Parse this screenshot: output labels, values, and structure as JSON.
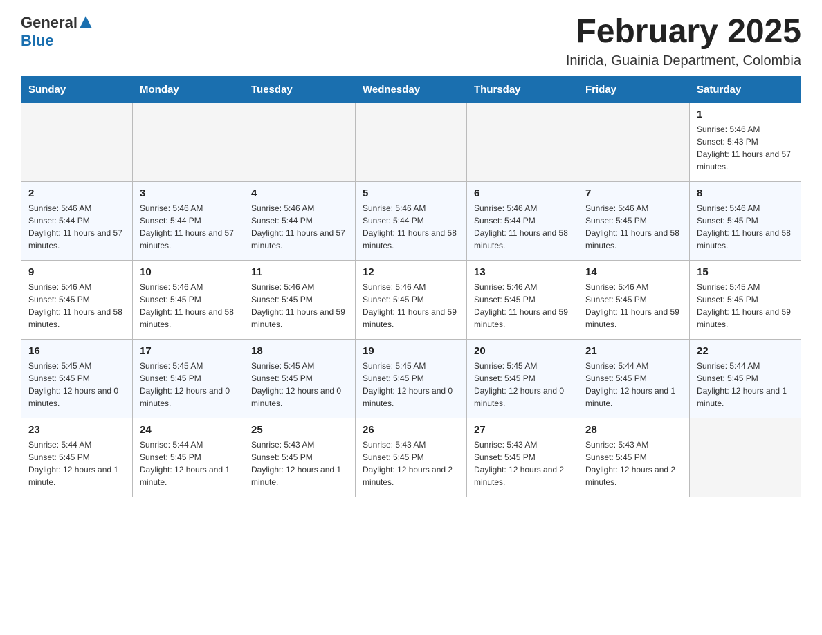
{
  "header": {
    "logo_general": "General",
    "logo_blue": "Blue",
    "title": "February 2025",
    "subtitle": "Inirida, Guainia Department, Colombia"
  },
  "days_of_week": [
    "Sunday",
    "Monday",
    "Tuesday",
    "Wednesday",
    "Thursday",
    "Friday",
    "Saturday"
  ],
  "weeks": [
    [
      {
        "day": "",
        "info": ""
      },
      {
        "day": "",
        "info": ""
      },
      {
        "day": "",
        "info": ""
      },
      {
        "day": "",
        "info": ""
      },
      {
        "day": "",
        "info": ""
      },
      {
        "day": "",
        "info": ""
      },
      {
        "day": "1",
        "info": "Sunrise: 5:46 AM\nSunset: 5:43 PM\nDaylight: 11 hours and 57 minutes."
      }
    ],
    [
      {
        "day": "2",
        "info": "Sunrise: 5:46 AM\nSunset: 5:44 PM\nDaylight: 11 hours and 57 minutes."
      },
      {
        "day": "3",
        "info": "Sunrise: 5:46 AM\nSunset: 5:44 PM\nDaylight: 11 hours and 57 minutes."
      },
      {
        "day": "4",
        "info": "Sunrise: 5:46 AM\nSunset: 5:44 PM\nDaylight: 11 hours and 57 minutes."
      },
      {
        "day": "5",
        "info": "Sunrise: 5:46 AM\nSunset: 5:44 PM\nDaylight: 11 hours and 58 minutes."
      },
      {
        "day": "6",
        "info": "Sunrise: 5:46 AM\nSunset: 5:44 PM\nDaylight: 11 hours and 58 minutes."
      },
      {
        "day": "7",
        "info": "Sunrise: 5:46 AM\nSunset: 5:45 PM\nDaylight: 11 hours and 58 minutes."
      },
      {
        "day": "8",
        "info": "Sunrise: 5:46 AM\nSunset: 5:45 PM\nDaylight: 11 hours and 58 minutes."
      }
    ],
    [
      {
        "day": "9",
        "info": "Sunrise: 5:46 AM\nSunset: 5:45 PM\nDaylight: 11 hours and 58 minutes."
      },
      {
        "day": "10",
        "info": "Sunrise: 5:46 AM\nSunset: 5:45 PM\nDaylight: 11 hours and 58 minutes."
      },
      {
        "day": "11",
        "info": "Sunrise: 5:46 AM\nSunset: 5:45 PM\nDaylight: 11 hours and 59 minutes."
      },
      {
        "day": "12",
        "info": "Sunrise: 5:46 AM\nSunset: 5:45 PM\nDaylight: 11 hours and 59 minutes."
      },
      {
        "day": "13",
        "info": "Sunrise: 5:46 AM\nSunset: 5:45 PM\nDaylight: 11 hours and 59 minutes."
      },
      {
        "day": "14",
        "info": "Sunrise: 5:46 AM\nSunset: 5:45 PM\nDaylight: 11 hours and 59 minutes."
      },
      {
        "day": "15",
        "info": "Sunrise: 5:45 AM\nSunset: 5:45 PM\nDaylight: 11 hours and 59 minutes."
      }
    ],
    [
      {
        "day": "16",
        "info": "Sunrise: 5:45 AM\nSunset: 5:45 PM\nDaylight: 12 hours and 0 minutes."
      },
      {
        "day": "17",
        "info": "Sunrise: 5:45 AM\nSunset: 5:45 PM\nDaylight: 12 hours and 0 minutes."
      },
      {
        "day": "18",
        "info": "Sunrise: 5:45 AM\nSunset: 5:45 PM\nDaylight: 12 hours and 0 minutes."
      },
      {
        "day": "19",
        "info": "Sunrise: 5:45 AM\nSunset: 5:45 PM\nDaylight: 12 hours and 0 minutes."
      },
      {
        "day": "20",
        "info": "Sunrise: 5:45 AM\nSunset: 5:45 PM\nDaylight: 12 hours and 0 minutes."
      },
      {
        "day": "21",
        "info": "Sunrise: 5:44 AM\nSunset: 5:45 PM\nDaylight: 12 hours and 1 minute."
      },
      {
        "day": "22",
        "info": "Sunrise: 5:44 AM\nSunset: 5:45 PM\nDaylight: 12 hours and 1 minute."
      }
    ],
    [
      {
        "day": "23",
        "info": "Sunrise: 5:44 AM\nSunset: 5:45 PM\nDaylight: 12 hours and 1 minute."
      },
      {
        "day": "24",
        "info": "Sunrise: 5:44 AM\nSunset: 5:45 PM\nDaylight: 12 hours and 1 minute."
      },
      {
        "day": "25",
        "info": "Sunrise: 5:43 AM\nSunset: 5:45 PM\nDaylight: 12 hours and 1 minute."
      },
      {
        "day": "26",
        "info": "Sunrise: 5:43 AM\nSunset: 5:45 PM\nDaylight: 12 hours and 2 minutes."
      },
      {
        "day": "27",
        "info": "Sunrise: 5:43 AM\nSunset: 5:45 PM\nDaylight: 12 hours and 2 minutes."
      },
      {
        "day": "28",
        "info": "Sunrise: 5:43 AM\nSunset: 5:45 PM\nDaylight: 12 hours and 2 minutes."
      },
      {
        "day": "",
        "info": ""
      }
    ]
  ]
}
